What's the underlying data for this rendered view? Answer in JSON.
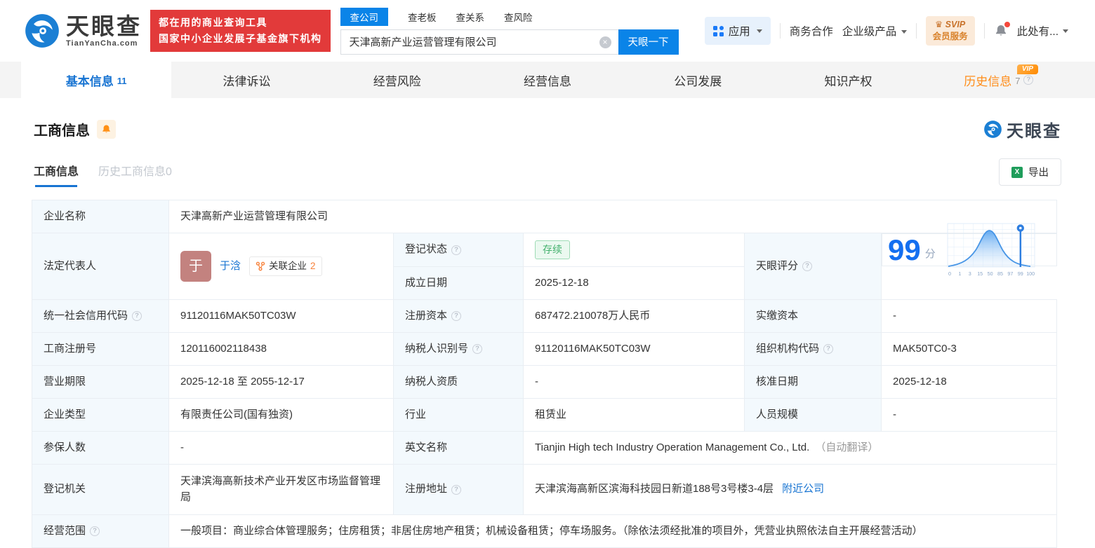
{
  "colors": {
    "primary_blue": "#0a84e8",
    "link_blue": "#1874d2",
    "accent_orange": "#ff8d1a",
    "status_green": "#44b16e",
    "banner_red": "#e23a3a"
  },
  "header": {
    "logo": {
      "brand": "天眼查",
      "domain": "TianYanCha.com"
    },
    "slogan": {
      "line1": "都在用的商业查询工具",
      "line2": "国家中小企业发展子基金旗下机构"
    },
    "search": {
      "tabs": [
        "查公司",
        "查老板",
        "查关系",
        "查风险"
      ],
      "value": "天津高新产业运营管理有限公司",
      "button": "天眼一下"
    },
    "nav": {
      "apps": "应用",
      "cooperation": "商务合作",
      "enterprise": "企业级产品",
      "svip_top": "SVIP",
      "svip_bottom": "会员服务",
      "user": "此处有..."
    }
  },
  "tabs": [
    {
      "label": "基本信息",
      "count": "11"
    },
    {
      "label": "法律诉讼"
    },
    {
      "label": "经营风险"
    },
    {
      "label": "经营信息"
    },
    {
      "label": "公司发展"
    },
    {
      "label": "知识产权"
    },
    {
      "label": "历史信息",
      "count": "7",
      "vip": "VIP"
    }
  ],
  "section": {
    "title": "工商信息",
    "subtabs": [
      {
        "label": "工商信息"
      },
      {
        "label": "历史工商信息0"
      }
    ],
    "export_label": "导出",
    "watermark": "天眼查"
  },
  "table": {
    "company_name": {
      "label": "企业名称",
      "value": "天津高新产业运营管理有限公司"
    },
    "legal_rep": {
      "label": "法定代表人",
      "name": "于浛",
      "avatar": "于",
      "badge_label": "关联企业",
      "badge_count": "2"
    },
    "reg_status": {
      "label": "登记状态",
      "value": "存续"
    },
    "established": {
      "label": "成立日期",
      "value": "2025-12-18"
    },
    "score": {
      "label": "天眼评分",
      "value": "99",
      "unit": "分",
      "ticks": [
        "0",
        "1",
        "3",
        "15",
        "50",
        "85",
        "97",
        "99",
        "100"
      ]
    },
    "credit_code": {
      "label": "统一社会信用代码",
      "value": "91120116MAK50TC03W"
    },
    "reg_capital": {
      "label": "注册资本",
      "value": "687472.210078万人民币"
    },
    "paid_capital": {
      "label": "实缴资本",
      "value": "-"
    },
    "reg_number": {
      "label": "工商注册号",
      "value": "120116002118438"
    },
    "taxpayer_id": {
      "label": "纳税人识别号",
      "value": "91120116MAK50TC03W"
    },
    "org_code": {
      "label": "组织机构代码",
      "value": "MAK50TC0-3"
    },
    "business_term": {
      "label": "营业期限",
      "value": "2025-12-18 至 2055-12-17"
    },
    "taxpayer_quality": {
      "label": "纳税人资质",
      "value": "-"
    },
    "approval_date": {
      "label": "核准日期",
      "value": "2025-12-18"
    },
    "company_type": {
      "label": "企业类型",
      "value": "有限责任公司(国有独资)"
    },
    "industry": {
      "label": "行业",
      "value": "租赁业"
    },
    "staff_size": {
      "label": "人员规模",
      "value": "-"
    },
    "insured_count": {
      "label": "参保人数",
      "value": "-"
    },
    "english_name": {
      "label": "英文名称",
      "value": "Tianjin High tech Industry Operation Management Co., Ltd.",
      "note": "（自动翻译）"
    },
    "reg_authority": {
      "label": "登记机关",
      "value": "天津滨海高新技术产业开发区市场监督管理局"
    },
    "reg_address": {
      "label": "注册地址",
      "value": "天津滨海高新区滨海科技园日新道188号3号楼3-4层",
      "link": "附近公司"
    },
    "business_scope": {
      "label": "经营范围",
      "value": "一般项目：商业综合体管理服务；住房租赁；非居住房地产租赁；机械设备租赁；停车场服务。（除依法须经批准的项目外，凭营业执照依法自主开展经营活动）"
    }
  }
}
